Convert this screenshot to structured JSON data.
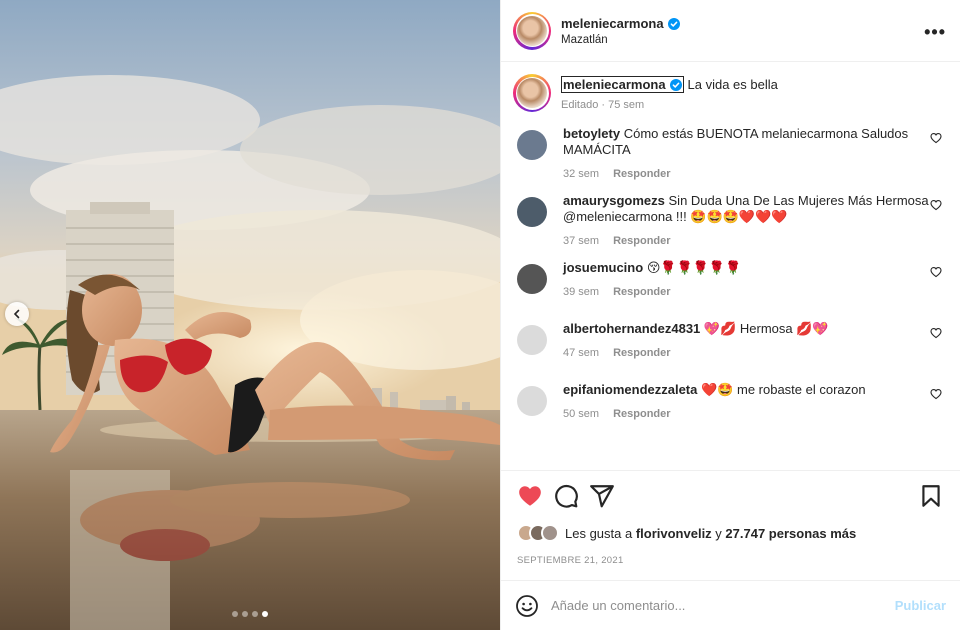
{
  "header": {
    "username": "meleniecarmona",
    "location": "Mazatlán",
    "more_label": "•••"
  },
  "caption": {
    "username": "meleniecarmona",
    "text": "La vida es bella",
    "meta": "Editado · 75 sem"
  },
  "comments": [
    {
      "user": "betoylety",
      "text": "Cómo estás BUENOTA melaniecarmona Saludos MAMÁCITA",
      "time": "32 sem",
      "reply": "Responder",
      "avatar_color": "#6b7a8f"
    },
    {
      "user": "amaurysgomezs",
      "text": "Sin Duda Una De Las Mujeres Más Hermosa @meleniecarmona !!! 🤩🤩🤩❤️❤️❤️",
      "time": "37 sem",
      "reply": "Responder",
      "avatar_color": "#4d5c6a"
    },
    {
      "user": "josuemucino",
      "text": "😚🌹🌹🌹🌹🌹",
      "time": "39 sem",
      "reply": "Responder",
      "avatar_color": "#555555"
    },
    {
      "user": "albertohernandez4831",
      "text": "💖💋 Hermosa 💋💖",
      "time": "47 sem",
      "reply": "Responder",
      "avatar_color": "#dbdbdb"
    },
    {
      "user": "epifaniomendezzaleta",
      "text": "❤️🤩 me robaste el corazon",
      "time": "50 sem",
      "reply": "Responder",
      "avatar_color": "#dbdbdb"
    }
  ],
  "likes": {
    "prefix": "Les gusta a ",
    "user": "florivonveliz",
    "middle": " y ",
    "count": "27.747 personas más"
  },
  "date": "SEPTIEMBRE 21, 2021",
  "add_comment": {
    "placeholder": "Añade un comentario...",
    "post_label": "Publicar"
  },
  "colors": {
    "heart": "#ed4956",
    "verified": "#0095f6",
    "post_disabled": "#b2dffc"
  },
  "carousel": {
    "total": 4,
    "active_index": 3
  }
}
